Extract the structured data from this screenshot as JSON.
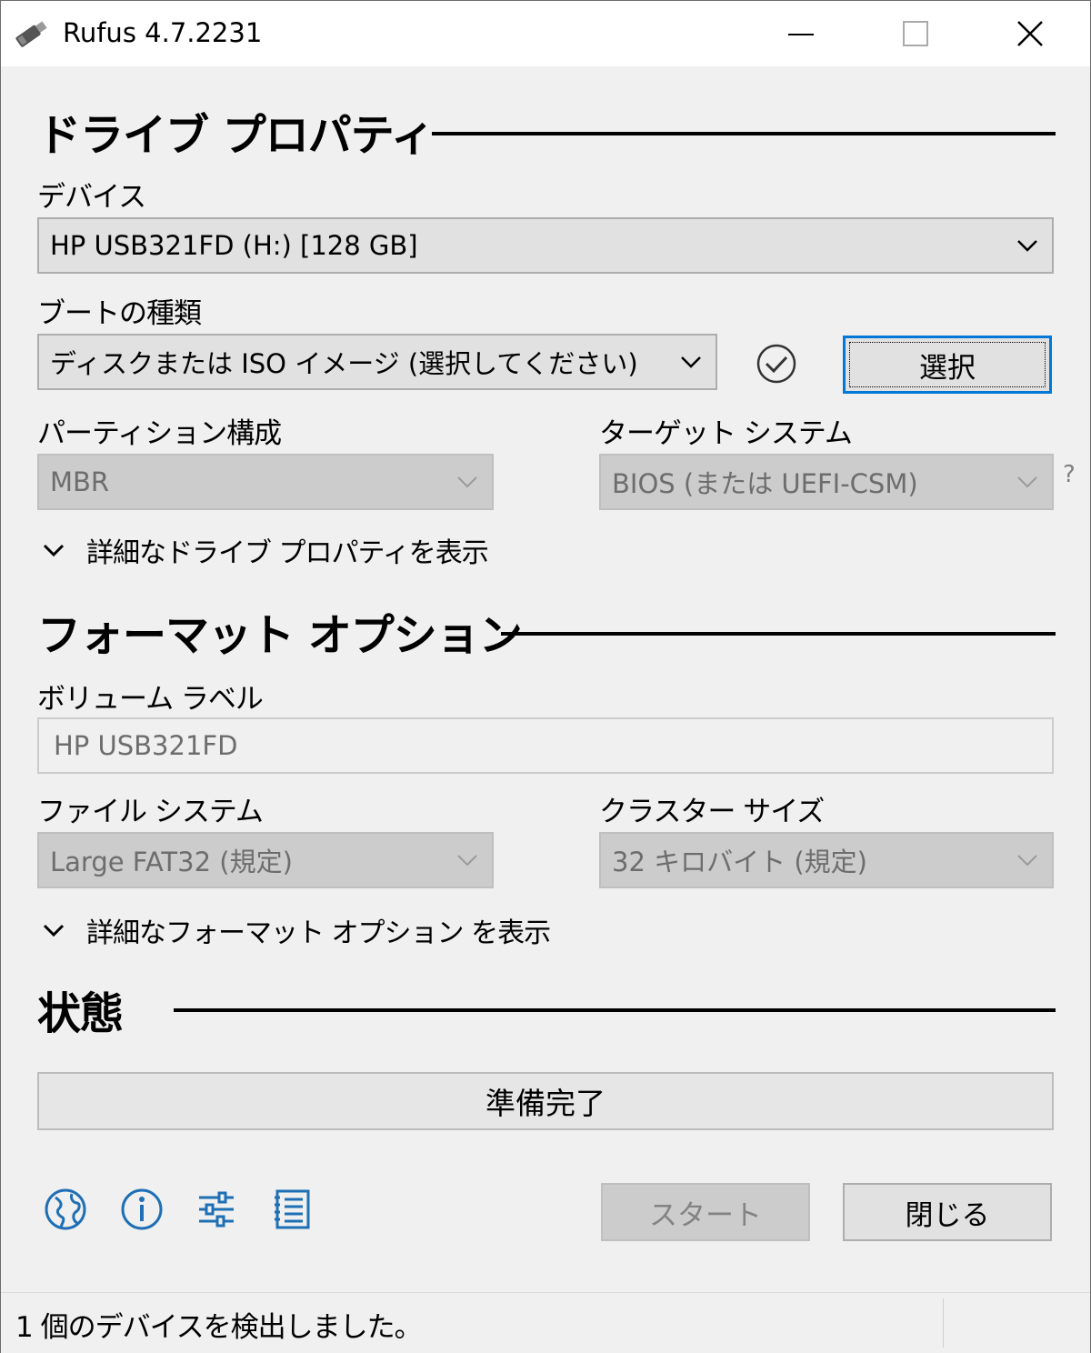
{
  "window": {
    "title": "Rufus 4.7.2231",
    "icon": "usb-drive-icon"
  },
  "drive_properties": {
    "heading": "ドライブ プロパティ",
    "device_label": "デバイス",
    "device_value": "HP USB321FD (H:) [128 GB]",
    "boot_type_label": "ブートの種類",
    "boot_type_value": "ディスクまたは ISO イメージ (選択してください)",
    "select_button": "選択",
    "partition_label": "パーティション構成",
    "partition_value": "MBR",
    "target_label": "ターゲット システム",
    "target_value": "BIOS (または UEFI-CSM)",
    "help": "?",
    "advanced_toggle": "詳細なドライブ プロパティを表示"
  },
  "format_options": {
    "heading": "フォーマット オプション",
    "volume_label_label": "ボリューム ラベル",
    "volume_label_value": "HP USB321FD",
    "filesystem_label": "ファイル システム",
    "filesystem_value": "Large FAT32 (規定)",
    "cluster_label": "クラスター サイズ",
    "cluster_value": "32 キロバイト (規定)",
    "advanced_toggle": "詳細なフォーマット オプション を表示"
  },
  "status": {
    "heading": "状態",
    "progress_text": "準備完了",
    "start_button": "スタート",
    "close_button": "閉じる"
  },
  "toolbar_icons": [
    "globe-icon",
    "info-icon",
    "settings-sliders-icon",
    "log-icon"
  ],
  "statusline": {
    "text": "1 個のデバイスを検出しました。"
  },
  "colors": {
    "accent": "#0078d7",
    "icon_blue": "#1e6fb5",
    "background": "#f0f0f0"
  }
}
